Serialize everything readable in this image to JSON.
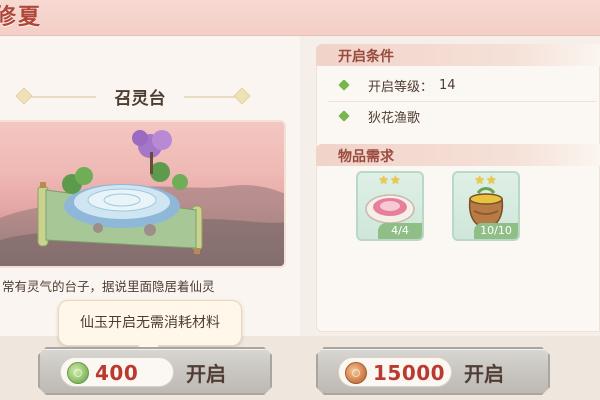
{
  "header": {
    "title": "修夏"
  },
  "left": {
    "title": "召灵台",
    "description": "常有灵气的台子，据说里面隐居着仙灵"
  },
  "conditions": {
    "heading": "开启条件",
    "items": [
      {
        "label": "开启等级：",
        "value": "14"
      },
      {
        "label": "狄花渔歌",
        "value": ""
      }
    ]
  },
  "requirements": {
    "heading": "物品需求",
    "items": [
      {
        "name": "plate",
        "count": "4/4",
        "stars": "★★"
      },
      {
        "name": "pot",
        "count": "10/10",
        "stars": "★★"
      }
    ]
  },
  "tooltip": "仙玉开启无需消耗材料",
  "buttons": [
    {
      "cost": "400",
      "label": "开启",
      "currency": "jade-coin-icon"
    },
    {
      "cost": "15000",
      "label": "开启",
      "currency": "copper-coin-icon"
    }
  ],
  "colors": {
    "accent": "#b93a2e",
    "bullet": "#79b64c",
    "item_bg": "#cfe6da"
  }
}
